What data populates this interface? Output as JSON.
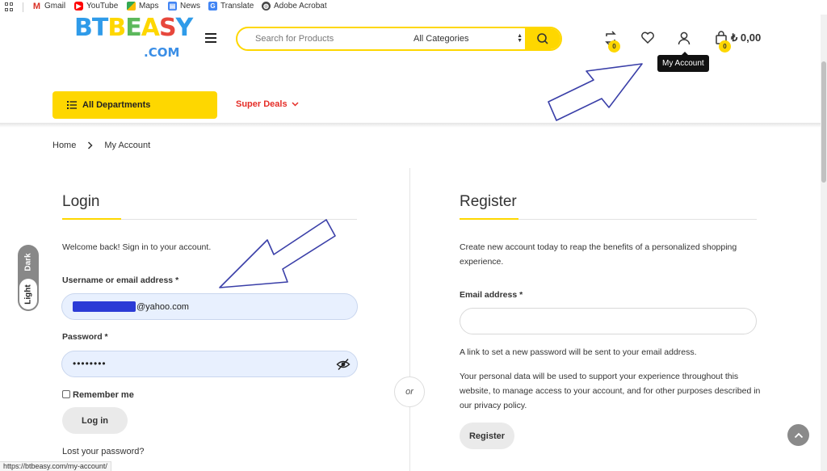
{
  "bookmarks": [
    {
      "label": "Gmail",
      "icon": "gmail-icon",
      "color": "#d93025"
    },
    {
      "label": "YouTube",
      "icon": "youtube-icon",
      "color": "#ff0000"
    },
    {
      "label": "Maps",
      "icon": "maps-icon",
      "color": "#34a853"
    },
    {
      "label": "News",
      "icon": "news-icon",
      "color": "#4285f4"
    },
    {
      "label": "Translate",
      "icon": "translate-icon",
      "color": "#4285f4"
    },
    {
      "label": "Adobe Acrobat",
      "icon": "globe-icon",
      "color": "#555555"
    }
  ],
  "header": {
    "logo_main": "BTBEASY",
    "logo_sub": ".COM",
    "search_placeholder": "Search for Products",
    "search_category": "All Categories",
    "compare_count": "0",
    "cart_count": "0",
    "cart_total": "₺ 0,00",
    "account_tooltip": "My Account"
  },
  "nav": {
    "departments_label": "All Departments",
    "super_deals_label": "Super Deals"
  },
  "breadcrumb": {
    "home": "Home",
    "current": "My Account"
  },
  "login": {
    "title": "Login",
    "welcome": "Welcome back! Sign in to your account.",
    "username_label": "Username or email address *",
    "username_value": "@yahoo.com",
    "password_label": "Password *",
    "password_value": "••••••••",
    "remember_label": "Remember me",
    "login_button": "Log in",
    "lost_password": "Lost your password?"
  },
  "divider_text": "or",
  "register": {
    "title": "Register",
    "intro": "Create new account today to reap the benefits of a personalized shopping experience.",
    "email_label": "Email address *",
    "email_value": "",
    "link_note": "A link to set a new password will be sent to your email address.",
    "privacy_note": "Your personal data will be used to support your experience throughout this website, to manage access to your account, and for other purposes described in our privacy policy.",
    "register_button": "Register"
  },
  "mode_toggle": {
    "dark": "Dark",
    "light": "Light"
  },
  "status_bar_url": "https://btbeasy.com/my-account/",
  "colors": {
    "accent": "#fed700",
    "super_deals": "#e52d27",
    "autofill": "#e8f0fe",
    "annotation_arrow": "#3a3fa8"
  }
}
